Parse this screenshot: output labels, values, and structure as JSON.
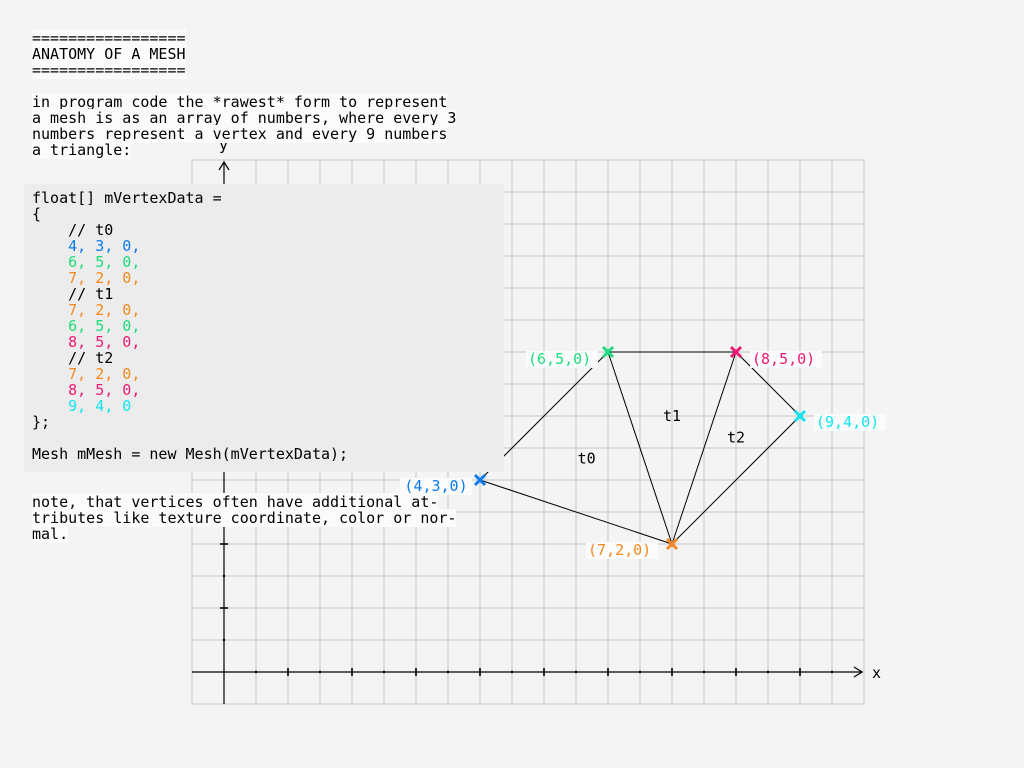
{
  "header": {
    "rule_top": "=================",
    "title": "ANATOMY OF A MESH",
    "rule_bottom": "================="
  },
  "intro": {
    "line1": "in program code the *rawest* form to represent",
    "line2": "a mesh is as an array of numbers, where every 3",
    "line3": "numbers represent a vertex and every 9 numbers",
    "line4": "a triangle:"
  },
  "code": {
    "decl": "float[] mVertexData =",
    "open": "{",
    "c_t0": "    // t0",
    "t0_v0": "    4, 3, 0,",
    "t0_v1": "    6, 5, 0,",
    "t0_v2": "    7, 2, 0,",
    "c_t1": "    // t1",
    "t1_v0": "    7, 2, 0,",
    "t1_v1": "    6, 5, 0,",
    "t1_v2": "    8, 5, 0,",
    "c_t2": "    // t2",
    "t2_v0": "    7, 2, 0,",
    "t2_v1": "    8, 5, 0,",
    "t2_v2": "    9, 4, 0",
    "close": "};",
    "blank": "",
    "mesh": "Mesh mMesh = new Mesh(mVertexData);"
  },
  "note": {
    "line1": "note, that vertices often have additional at-",
    "line2": "tributes like texture coordinate, color or nor-",
    "line3": "mal."
  },
  "diagram": {
    "x_axis_label": "x",
    "y_axis_label": "y",
    "vertices": [
      {
        "id": "v0",
        "x": 4,
        "y": 3,
        "z": 0,
        "label": "(4,3,0)",
        "color": "#0a7cf0"
      },
      {
        "id": "v1",
        "x": 6,
        "y": 5,
        "z": 0,
        "label": "(6,5,0)",
        "color": "#1ddc7b"
      },
      {
        "id": "v2",
        "x": 7,
        "y": 2,
        "z": 0,
        "label": "(7,2,0)",
        "color": "#f5891f"
      },
      {
        "id": "v3",
        "x": 8,
        "y": 5,
        "z": 0,
        "label": "(8,5,0)",
        "color": "#ee1a74"
      },
      {
        "id": "v4",
        "x": 9,
        "y": 4,
        "z": 0,
        "label": "(9,4,0)",
        "color": "#10e6f0"
      }
    ],
    "triangles": [
      {
        "label": "t0",
        "vertices": [
          "v0",
          "v1",
          "v2"
        ]
      },
      {
        "label": "t1",
        "vertices": [
          "v2",
          "v1",
          "v3"
        ]
      },
      {
        "label": "t2",
        "vertices": [
          "v2",
          "v3",
          "v4"
        ]
      }
    ]
  },
  "colors": {
    "background": "#f4f4f4",
    "grid": "#c4c4c4",
    "code_panel": "#ececec",
    "vertex_4_3_0": "#0a7cf0",
    "vertex_6_5_0": "#1ddc7b",
    "vertex_7_2_0": "#f5891f",
    "vertex_8_5_0": "#ee1a74",
    "vertex_9_4_0": "#10e6f0"
  }
}
